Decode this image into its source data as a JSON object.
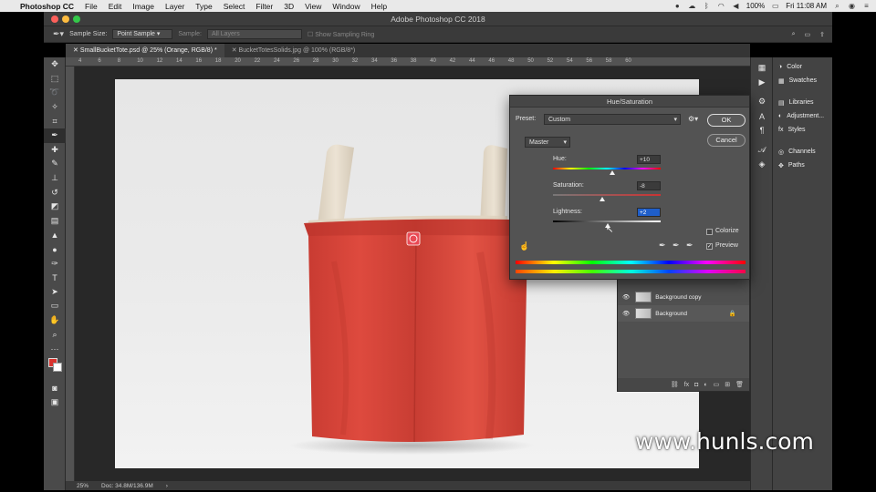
{
  "menubar": {
    "app": "Photoshop CC",
    "items": [
      "File",
      "Edit",
      "Image",
      "Layer",
      "Type",
      "Select",
      "Filter",
      "3D",
      "View",
      "Window",
      "Help"
    ],
    "battery": "100%",
    "clock": "Fri 11:08 AM"
  },
  "window": {
    "title": "Adobe Photoshop CC 2018"
  },
  "options": {
    "sample_size_label": "Sample Size:",
    "sample_size_value": "Point Sample",
    "sample_label": "Sample:",
    "sample_value": "All Layers",
    "show_ring": "Show Sampling Ring"
  },
  "tabs": [
    {
      "label": "SmallBucketTote.psd @ 25% (Orange, RGB/8) *"
    },
    {
      "label": "BucketTotesSolids.jpg @ 100% (RGB/8*)"
    }
  ],
  "ruler_ticks": [
    "4",
    "6",
    "8",
    "10",
    "12",
    "14",
    "16",
    "18",
    "20",
    "22",
    "24",
    "26",
    "28",
    "30",
    "32",
    "34",
    "36",
    "38",
    "40",
    "42",
    "44",
    "46",
    "48",
    "50",
    "52",
    "54",
    "56",
    "58",
    "60"
  ],
  "status": {
    "zoom": "25%",
    "doc": "Doc: 34.8M/136.9M"
  },
  "panels": {
    "color": "Color",
    "swatches": "Swatches",
    "libraries": "Libraries",
    "adjustments": "Adjustment...",
    "styles": "Styles",
    "channels": "Channels",
    "paths": "Paths"
  },
  "layers": {
    "rows": [
      {
        "name": "Background copy"
      },
      {
        "name": "Background"
      }
    ]
  },
  "hue_sat": {
    "title": "Hue/Saturation",
    "preset_label": "Preset:",
    "preset_value": "Custom",
    "channel": "Master",
    "ok": "OK",
    "cancel": "Cancel",
    "hue_label": "Hue:",
    "hue_value": "+10",
    "saturation_label": "Saturation:",
    "saturation_value": "-8",
    "lightness_label": "Lightness:",
    "lightness_value": "+2",
    "colorize": "Colorize",
    "preview": "Preview",
    "colors": {
      "accent": "#1f5ec9",
      "bag_red": "#d9453a",
      "handle": "#e7dccb"
    }
  },
  "watermark": "www.hunls.com"
}
